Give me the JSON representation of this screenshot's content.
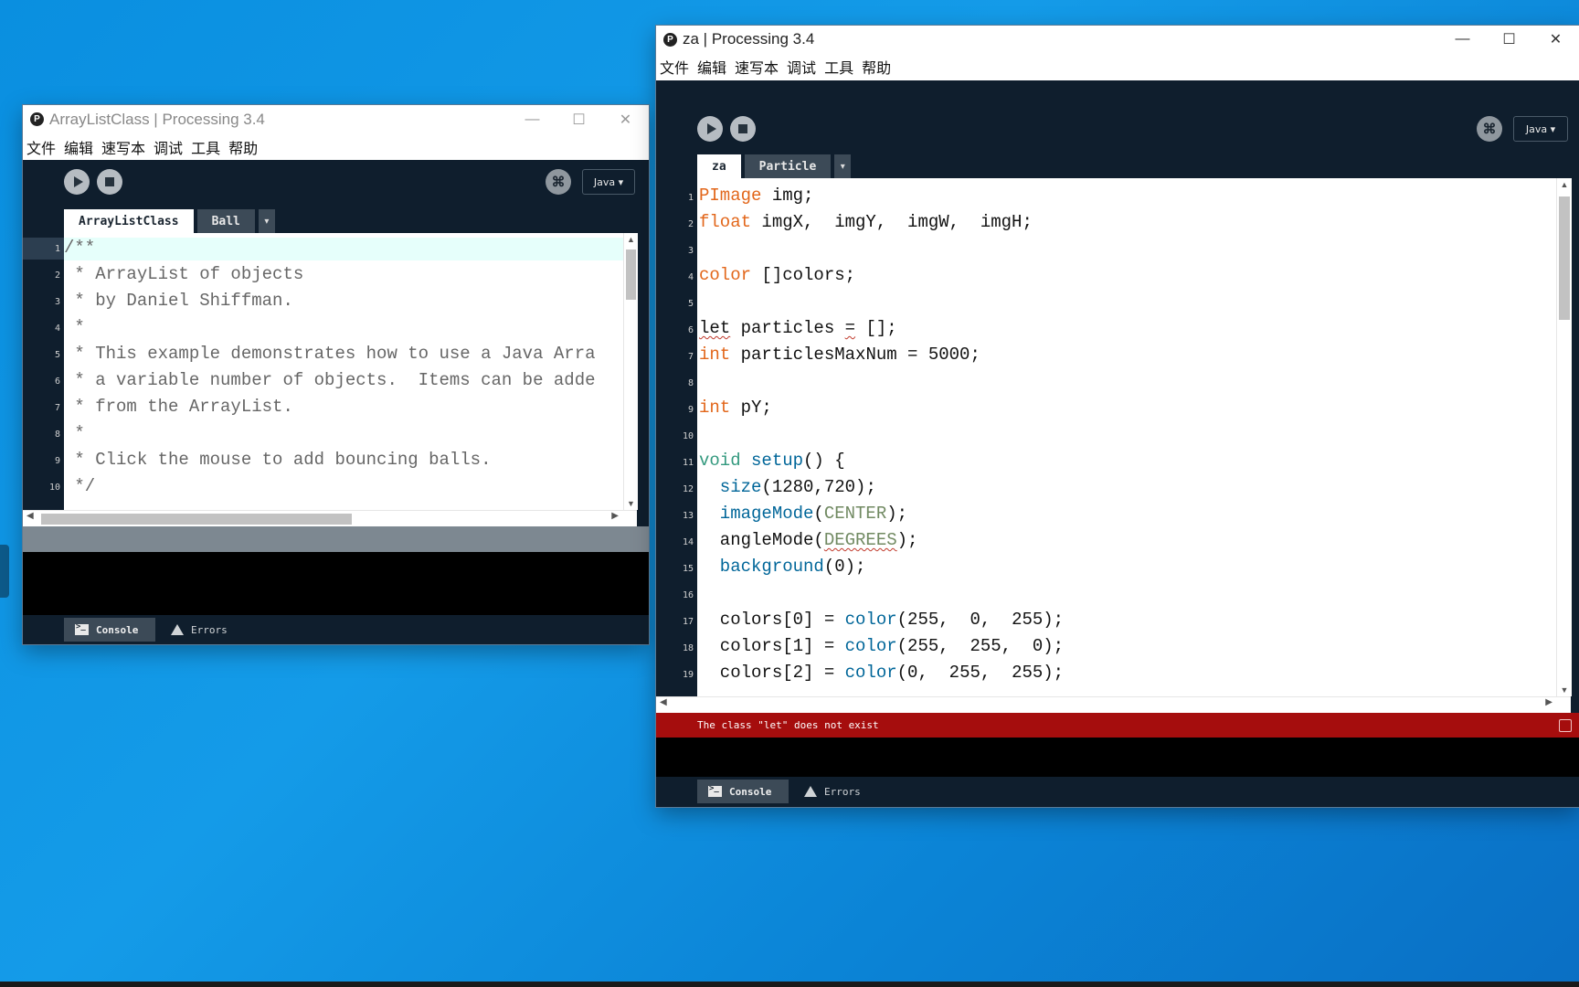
{
  "left_window": {
    "title": "ArrayListClass | Processing 3.4",
    "menu": [
      "文件",
      "编辑",
      "速写本",
      "调试",
      "工具",
      "帮助"
    ],
    "mode": "Java ▾",
    "debug_glyph": "⌘",
    "tabs": [
      "ArrayListClass",
      "Ball"
    ],
    "tab_arrow": "▾",
    "line_numbers": [
      "1",
      "2",
      "3",
      "4",
      "5",
      "6",
      "7",
      "8",
      "9",
      "10"
    ],
    "code": [
      "/**",
      " * ArrayList of objects",
      " * by Daniel Shiffman.",
      " *",
      " * This example demonstrates how to use a Java Arra",
      " * a variable number of objects.  Items can be adde",
      " * from the ArrayList.",
      " *",
      " * Click the mouse to add bouncing balls.",
      " */"
    ],
    "footer": {
      "console": "Console",
      "errors": "Errors"
    }
  },
  "right_window": {
    "title": "za | Processing 3.4",
    "menu": [
      "文件",
      "编辑",
      "速写本",
      "调试",
      "工具",
      "帮助"
    ],
    "mode": "Java ▾",
    "debug_glyph": "⌘",
    "tabs": [
      "za",
      "Particle"
    ],
    "tab_arrow": "▾",
    "line_numbers": [
      "1",
      "2",
      "3",
      "4",
      "5",
      "6",
      "7",
      "8",
      "9",
      "10",
      "11",
      "12",
      "13",
      "14",
      "15",
      "16",
      "17",
      "18",
      "19"
    ],
    "code": {
      "l1": {
        "t": "PImage",
        "r": " img;"
      },
      "l2": {
        "t": "float",
        "r": " imgX,  imgY,  imgW,  imgH;"
      },
      "l4": {
        "t": "color",
        "r": " []colors;"
      },
      "l6": {
        "a": "let",
        "b": " particles ",
        "c": "=",
        "d": " [];"
      },
      "l7": {
        "t": "int",
        "r": " particlesMaxNum = 5000;"
      },
      "l9": {
        "t": "int",
        "r": " pY;"
      },
      "l11": {
        "v": "void",
        "f": " setup",
        "r": "() {"
      },
      "l12": {
        "f": "  size",
        "r": "(1280,720);"
      },
      "l13": {
        "f": "  imageMode",
        "p": "(",
        "c": "CENTER",
        "r": ");"
      },
      "l14": {
        "p": "  angleMode(",
        "c": "DEGREES",
        "r": ");"
      },
      "l15": {
        "f": "  background",
        "r": "(0);"
      },
      "l17": {
        "p": "  colors[0] = ",
        "f": "color",
        "r": "(255,  0,  255);"
      },
      "l18": {
        "p": "  colors[1] = ",
        "f": "color",
        "r": "(255,  255,  0);"
      },
      "l19": {
        "p": "  colors[2] = ",
        "f": "color",
        "r": "(0,  255,  255);"
      }
    },
    "error_message": "The class \"let\" does not exist",
    "footer": {
      "console": "Console",
      "errors": "Errors"
    }
  },
  "colors": {
    "error_bar": "#a50d0d",
    "keyword_type": "#e2661a",
    "keyword_void": "#33997e",
    "function": "#006699",
    "constant": "#718a62",
    "ide_dark": "#0f1e2d"
  }
}
